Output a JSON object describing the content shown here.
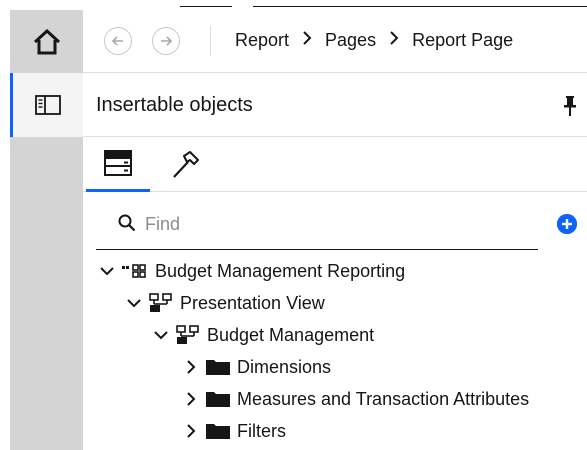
{
  "breadcrumb": [
    "Report",
    "Pages",
    "Report Page"
  ],
  "panel": {
    "title": "Insertable objects"
  },
  "tabs": [
    {
      "id": "data",
      "icon": "data-source-icon",
      "selected": true
    },
    {
      "id": "toolbox",
      "icon": "hammer-icon",
      "selected": false
    }
  ],
  "search": {
    "placeholder": "Find",
    "value": ""
  },
  "tree": [
    {
      "label": "Budget Management Reporting",
      "icon": "package-icon",
      "expanded": true,
      "level": 0
    },
    {
      "label": "Presentation View",
      "icon": "namespace-icon",
      "expanded": true,
      "level": 1
    },
    {
      "label": "Budget Management",
      "icon": "namespace-icon",
      "expanded": true,
      "level": 2
    },
    {
      "label": "Dimensions",
      "icon": "folder-icon",
      "expanded": false,
      "level": 3
    },
    {
      "label": "Measures and Transaction Attributes",
      "icon": "folder-icon",
      "expanded": false,
      "level": 3
    },
    {
      "label": "Filters",
      "icon": "folder-icon",
      "expanded": false,
      "level": 3
    }
  ],
  "colors": {
    "accent": "#0f62fe",
    "rail": "#d4d4d4",
    "text": "#161616"
  }
}
